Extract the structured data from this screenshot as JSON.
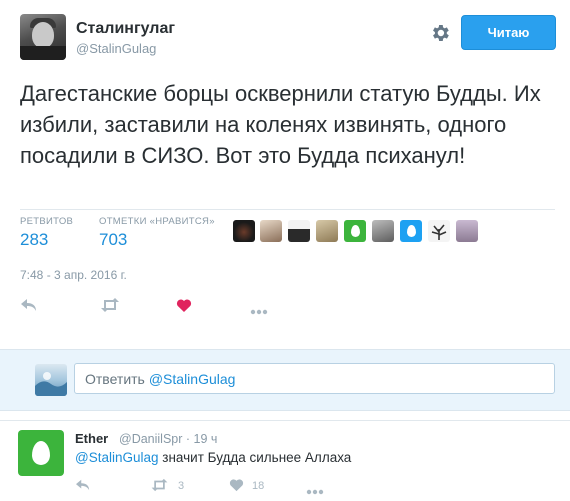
{
  "author": {
    "name": "Сталингулаг",
    "handle": "@StalinGulag",
    "follow_label": "Читаю"
  },
  "tweet": {
    "text": "Дагестанские борцы осквернили статую Будды. Их избили, заставили на коленях извинять, одного посадили в СИЗО. Вот это Будда психанул!",
    "timestamp": "7:48 - 3 апр. 2016 г."
  },
  "stats": {
    "retweets_label": "РЕТВИТОВ",
    "retweets_value": "283",
    "likes_label": "ОТМЕТКИ «НРАВИТСЯ»",
    "likes_value": "703"
  },
  "likers": [
    {
      "icon": "avatar-dark"
    },
    {
      "icon": "avatar-portrait"
    },
    {
      "icon": "avatar-figure"
    },
    {
      "icon": "avatar-sepia"
    },
    {
      "icon": "avatar-egg"
    },
    {
      "icon": "avatar-grey"
    },
    {
      "icon": "avatar-egg"
    },
    {
      "icon": "avatar-tree"
    },
    {
      "icon": "avatar-person"
    }
  ],
  "actions": {
    "reply_icon": "reply-icon",
    "retweet_icon": "retweet-icon",
    "like_icon": "heart-icon",
    "like_color": "#e0245e",
    "more_icon": "more-icon"
  },
  "reply_box": {
    "prefix": "Ответить",
    "mention": "@StalinGulag"
  },
  "comment": {
    "name": "Ether",
    "handle": "@DaniilSpr",
    "time": "19 ч",
    "mention": "@StalinGulag",
    "text": "значит Будда сильнее Аллаха",
    "retweets": "3",
    "likes": "18"
  },
  "colors": {
    "accent": "#2aa0ee",
    "link": "#1d8ed8",
    "egg_green": "#3cb43c"
  }
}
